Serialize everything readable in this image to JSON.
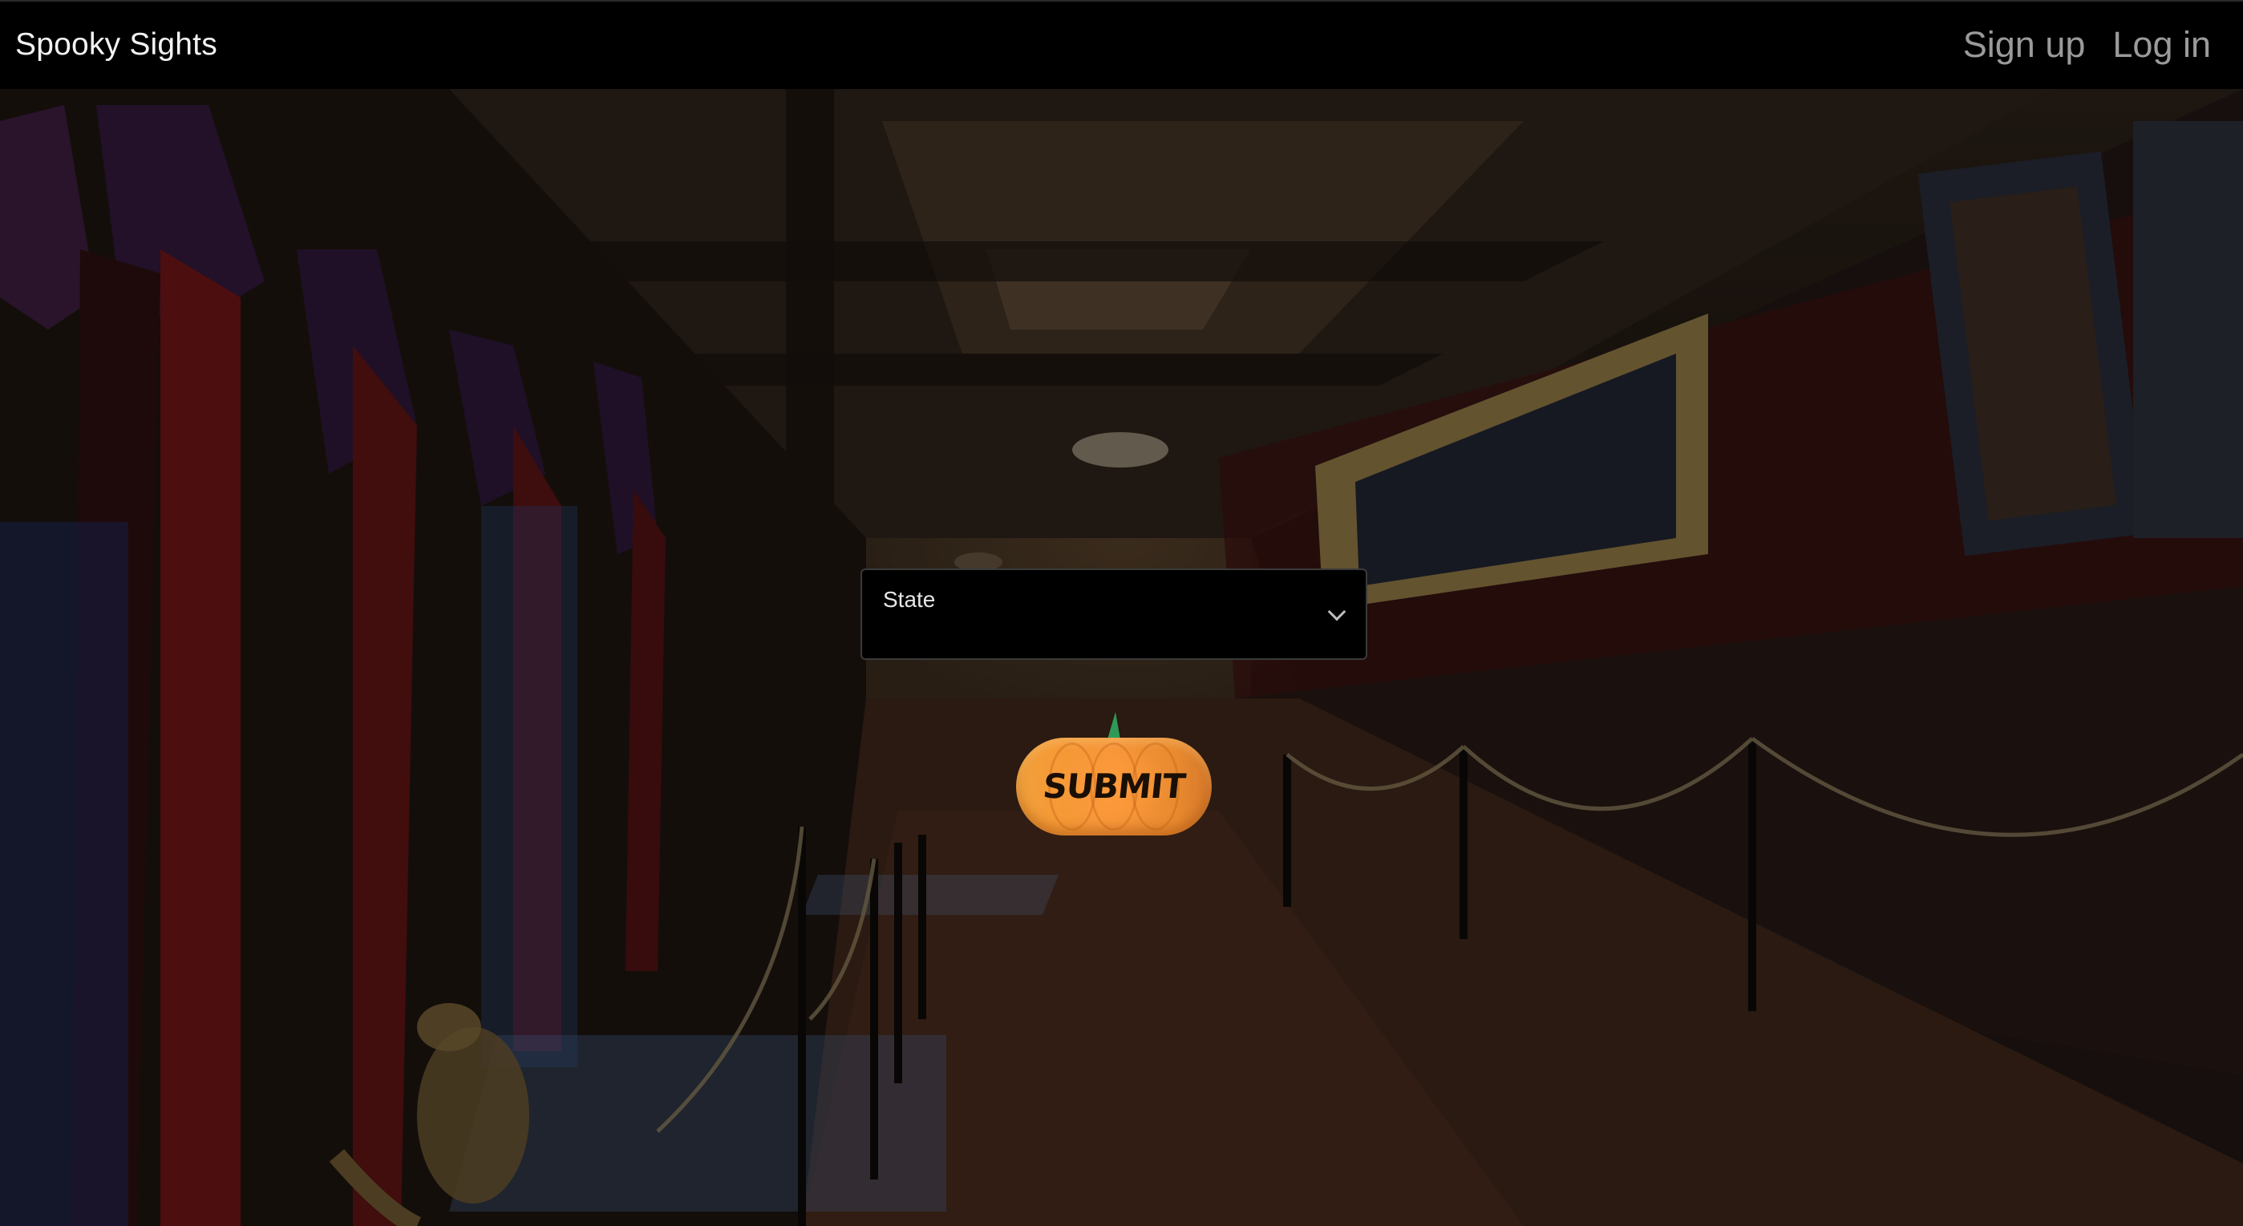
{
  "navbar": {
    "brand": "Spooky Sights",
    "links": {
      "signup": "Sign up",
      "login": "Log in"
    }
  },
  "form": {
    "state_select": {
      "label": "State",
      "selected_value": ""
    },
    "submit_label": "SUBMIT"
  },
  "colors": {
    "navbar_bg": "#000000",
    "link_color": "#9a9a9a",
    "pumpkin_orange": "#f6963a",
    "stem_green": "#2e9a57"
  },
  "icons": {
    "select_chevron": "chevron-down-icon",
    "submit_decoration": "pumpkin-icon"
  }
}
